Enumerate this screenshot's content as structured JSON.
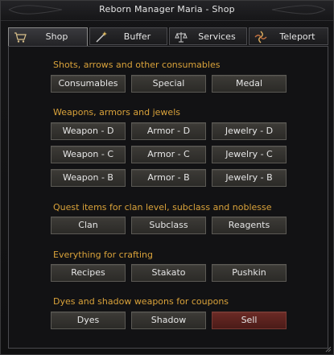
{
  "window": {
    "title": "Reborn Manager Maria - Shop"
  },
  "tabs": [
    {
      "label": "Shop",
      "icon": "cart-icon"
    },
    {
      "label": "Buffer",
      "icon": "wand-icon"
    },
    {
      "label": "Services",
      "icon": "scales-icon"
    },
    {
      "label": "Teleport",
      "icon": "teleport-icon"
    }
  ],
  "sections": [
    {
      "title": "Shots, arrows and other consumables",
      "buttons": [
        "Consumables",
        "Special",
        "Medal"
      ]
    },
    {
      "title": "Weapons, armors and jewels",
      "buttons": [
        "Weapon - D",
        "Armor - D",
        "Jewelry - D",
        "Weapon - C",
        "Armor - C",
        "Jewelry - C",
        "Weapon - B",
        "Armor - B",
        "Jewelry - B"
      ]
    },
    {
      "title": "Quest items for clan level, subclass and noblesse",
      "buttons": [
        "Clan",
        "Subclass",
        "Reagents"
      ]
    },
    {
      "title": "Everything for crafting",
      "buttons": [
        "Recipes",
        "Stakato",
        "Pushkin"
      ]
    },
    {
      "title": "Dyes and shadow weapons for coupons",
      "buttons": [
        "Dyes",
        "Shadow",
        "Sell"
      ]
    }
  ],
  "colors": {
    "section_title": "#d9a23a",
    "danger_button": "#5a221e"
  }
}
